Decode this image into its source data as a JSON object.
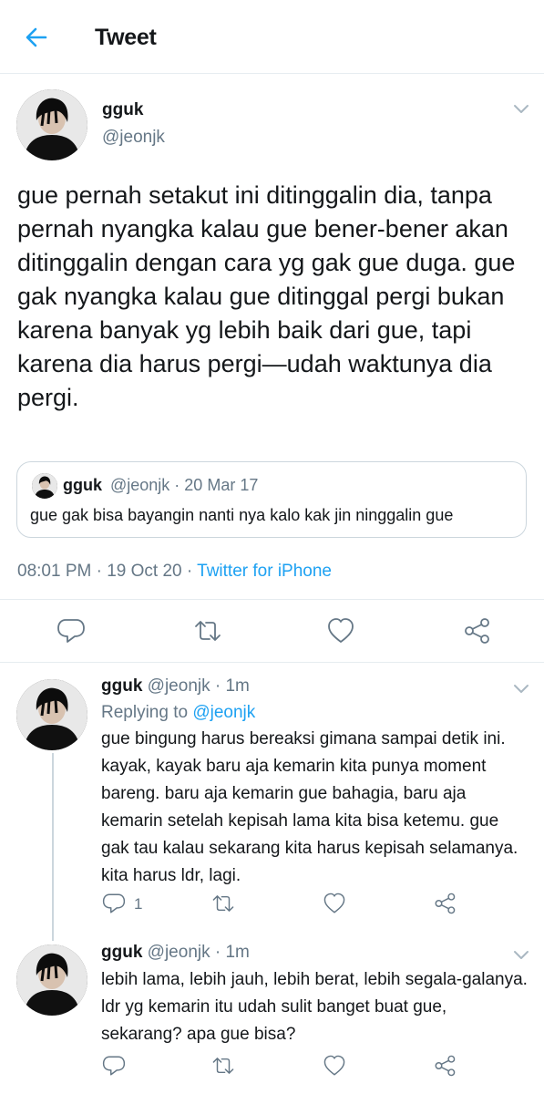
{
  "header": {
    "title": "Tweet",
    "back_icon": "arrow-left-icon",
    "accent": "#1da1f2"
  },
  "tweet": {
    "name": "gguk",
    "handle": "@jeonjk",
    "text": "gue pernah setakut ini ditinggalin dia, tanpa pernah nyangka kalau gue bener-bener akan ditinggalin dengan cara yg gak gue duga. gue gak nyangka kalau gue ditinggal pergi bukan karena banyak yg lebih baik dari gue, tapi karena dia harus pergi—udah waktunya dia pergi.",
    "quote": {
      "name": "gguk",
      "handle_date": "@jeonjk · 20 Mar 17",
      "text": "gue gak bisa bayangin nanti nya kalo kak jin ninggalin gue"
    },
    "time": "08:01 PM",
    "date": "19 Oct 20",
    "separator": "·",
    "client": "Twitter for iPhone",
    "actions": [
      "reply-icon",
      "retweet-icon",
      "like-icon",
      "share-icon"
    ]
  },
  "replies": [
    {
      "name": "gguk",
      "handle_time": "@jeonjk · 1m",
      "replying_label": "Replying to",
      "replying_to": "@jeonjk",
      "text": "gue bingung harus bereaksi gimana sampai detik ini. kayak, kayak baru aja kemarin kita punya moment bareng. baru aja kemarin gue bahagia, baru aja kemarin setelah kepisah lama kita bisa ketemu. gue gak tau kalau sekarang kita harus kepisah selamanya. kita harus ldr, lagi.",
      "reply_count": "1"
    },
    {
      "name": "gguk",
      "handle_time": "@jeonjk · 1m",
      "text": "lebih lama, lebih jauh, lebih berat, lebih segala-galanya. ldr yg kemarin itu udah sulit banget buat gue, sekarang? apa gue bisa?"
    }
  ]
}
